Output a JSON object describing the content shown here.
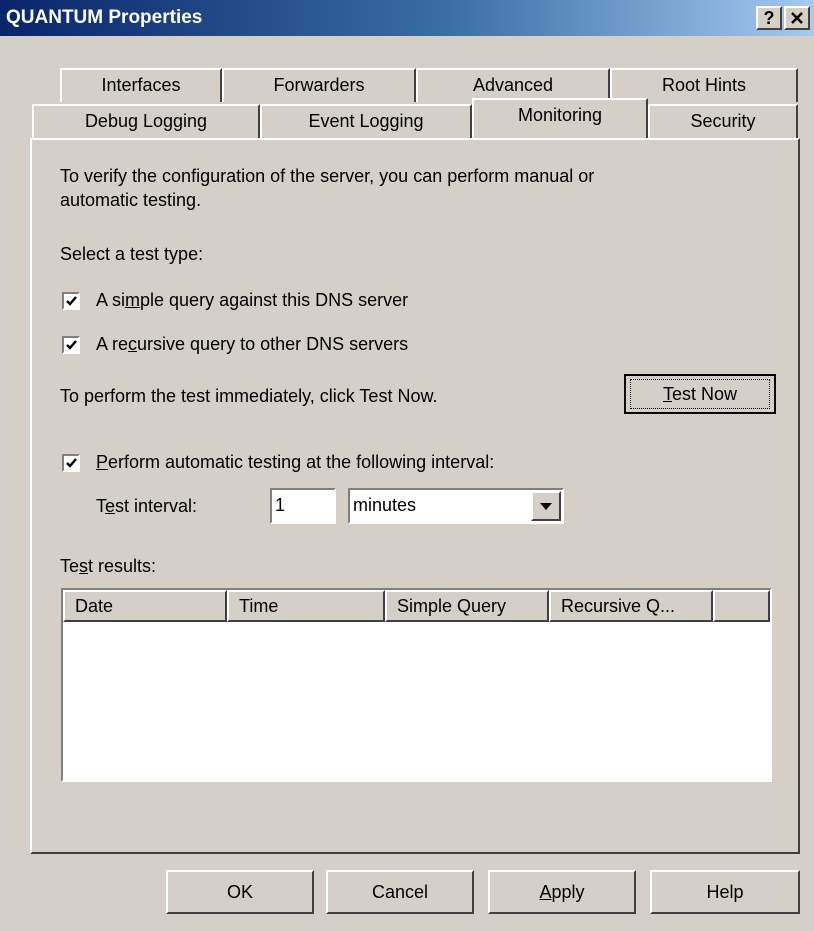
{
  "window": {
    "title": "QUANTUM Properties",
    "help_button": "?",
    "close_button": "✕"
  },
  "tabs": {
    "row1": [
      {
        "label": "Interfaces"
      },
      {
        "label": "Forwarders"
      },
      {
        "label": "Advanced"
      },
      {
        "label": "Root Hints"
      }
    ],
    "row2": [
      {
        "label": "Debug Logging"
      },
      {
        "label": "Event Logging"
      },
      {
        "label": "Monitoring"
      },
      {
        "label": "Security"
      }
    ],
    "active": "Monitoring"
  },
  "monitoring": {
    "intro_line1": "To verify the configuration of the server, you can perform manual or",
    "intro_line2": "automatic testing.",
    "select_label": "Select a test type:",
    "simple_query": {
      "pre": "A si",
      "key": "m",
      "post": "ple query against this DNS server",
      "checked": true
    },
    "recursive_query": {
      "pre": "A re",
      "key": "c",
      "post": "ursive query to other DNS servers",
      "checked": true
    },
    "test_now_text": "To perform the test immediately, click Test Now.",
    "test_now_button": {
      "key": "T",
      "rest": "est Now"
    },
    "auto_testing": {
      "key": "P",
      "rest": "erform automatic testing at the following interval:",
      "checked": true
    },
    "interval_label": {
      "pre": "T",
      "key": "e",
      "post": "st interval:"
    },
    "interval_value": "1",
    "interval_unit": "minutes",
    "results_label": {
      "pre": "Te",
      "key": "s",
      "post": "t results:"
    },
    "results_columns": [
      "Date",
      "Time",
      "Simple Query",
      "Recursive Q...",
      ""
    ]
  },
  "footer": {
    "ok": "OK",
    "cancel": "Cancel",
    "apply": {
      "key": "A",
      "rest": "pply"
    },
    "help": "Help"
  }
}
